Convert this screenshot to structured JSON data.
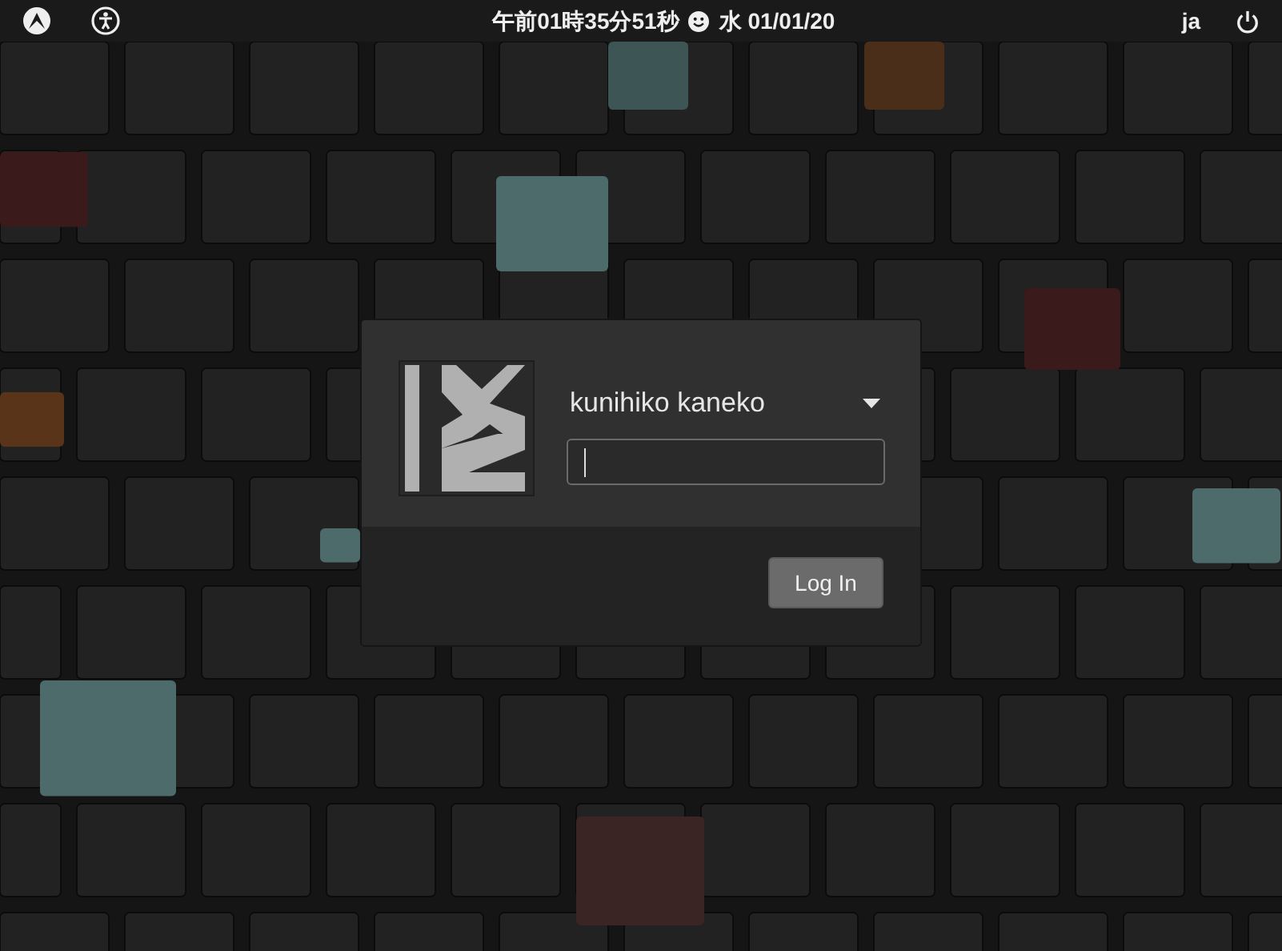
{
  "top_bar": {
    "time": "午前01時35分51秒",
    "date": "水 01/01/20",
    "language": "ja"
  },
  "login": {
    "user_name": "kunihiko kaneko",
    "button": "Log In"
  }
}
